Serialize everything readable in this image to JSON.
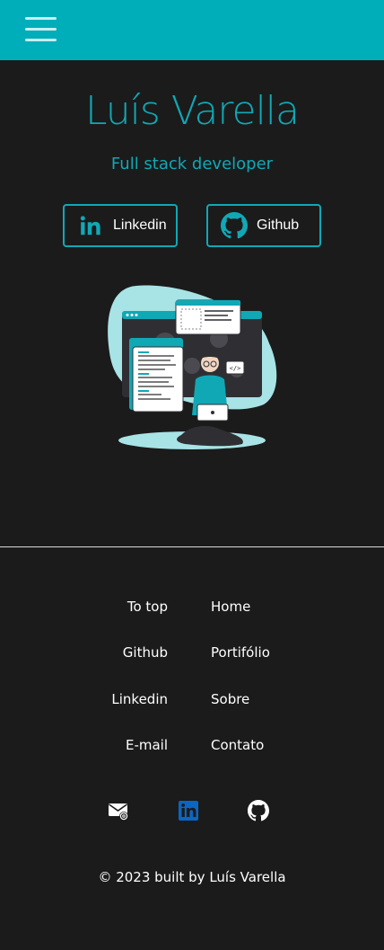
{
  "header": {
    "menu_icon": "hamburger-menu-icon",
    "color": "#00aeb9"
  },
  "hero": {
    "name": "Luís Varella",
    "role": "Full stack developer",
    "accent": "#11a8b6",
    "buttons": [
      {
        "label": "Linkedin",
        "icon": "linkedin-icon"
      },
      {
        "label": "Github",
        "icon": "github-icon"
      }
    ],
    "illustration": "developer-with-laptop-illustration"
  },
  "footer": {
    "left_links": [
      "To top",
      "Github",
      "Linkedin",
      "E-mail"
    ],
    "right_links": [
      "Home",
      "Portifólio",
      "Sobre",
      "Contato"
    ],
    "icons": [
      "email-icon",
      "linkedin-icon",
      "github-icon"
    ],
    "copyright": "© 2023 built by Luís Varella"
  }
}
